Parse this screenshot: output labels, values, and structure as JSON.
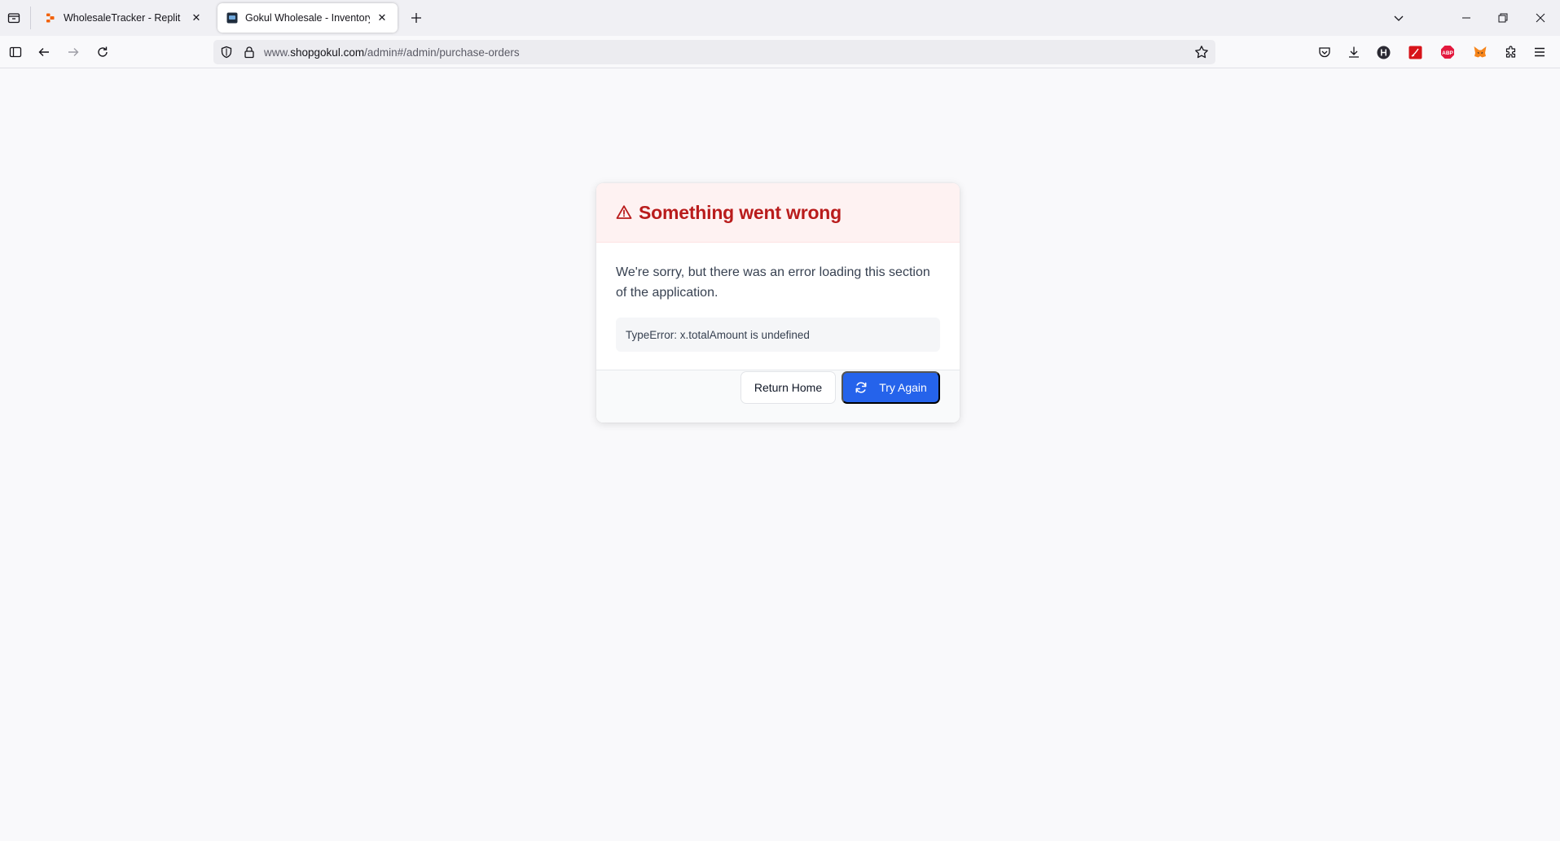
{
  "browser": {
    "tabs": [
      {
        "title": "WholesaleTracker - Replit",
        "active": false,
        "favicon": "replit-icon"
      },
      {
        "title": "Gokul Wholesale - Inventory &",
        "active": true,
        "favicon": "site-favicon"
      }
    ],
    "url": {
      "prefix": "www.",
      "host": "shopgokul.com",
      "path": "/admin#/admin/purchase-orders"
    },
    "toolbar_icons": [
      "pocket-icon",
      "download-icon",
      "h-extension-icon",
      "pdf-extension-icon",
      "adblock-icon",
      "metamask-icon",
      "extensions-icon",
      "menu-icon"
    ]
  },
  "error_card": {
    "title": "Something went wrong",
    "message": "We're sorry, but there was an error loading this section of the application.",
    "error_detail": "TypeError: x.totalAmount is undefined",
    "return_label": "Return Home",
    "retry_label": "Try Again"
  },
  "colors": {
    "primary": "#2563eb",
    "danger": "#b91c1c",
    "danger_bg": "#fef2f2"
  }
}
